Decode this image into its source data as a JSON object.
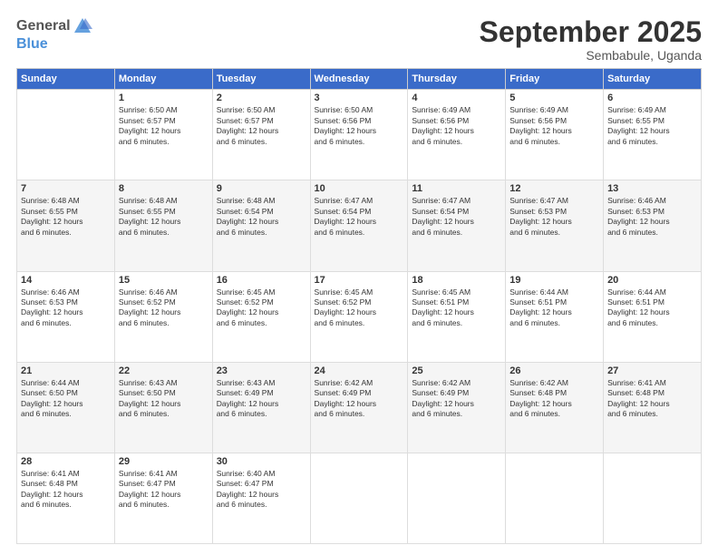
{
  "logo": {
    "general": "General",
    "blue": "Blue"
  },
  "header": {
    "month": "September 2025",
    "location": "Sembabule, Uganda"
  },
  "days": [
    "Sunday",
    "Monday",
    "Tuesday",
    "Wednesday",
    "Thursday",
    "Friday",
    "Saturday"
  ],
  "weeks": [
    [
      {
        "day": "",
        "sunrise": "",
        "sunset": "",
        "daylight": ""
      },
      {
        "day": "1",
        "sunrise": "Sunrise: 6:50 AM",
        "sunset": "Sunset: 6:57 PM",
        "daylight": "Daylight: 12 hours and 6 minutes."
      },
      {
        "day": "2",
        "sunrise": "Sunrise: 6:50 AM",
        "sunset": "Sunset: 6:57 PM",
        "daylight": "Daylight: 12 hours and 6 minutes."
      },
      {
        "day": "3",
        "sunrise": "Sunrise: 6:50 AM",
        "sunset": "Sunset: 6:56 PM",
        "daylight": "Daylight: 12 hours and 6 minutes."
      },
      {
        "day": "4",
        "sunrise": "Sunrise: 6:49 AM",
        "sunset": "Sunset: 6:56 PM",
        "daylight": "Daylight: 12 hours and 6 minutes."
      },
      {
        "day": "5",
        "sunrise": "Sunrise: 6:49 AM",
        "sunset": "Sunset: 6:56 PM",
        "daylight": "Daylight: 12 hours and 6 minutes."
      },
      {
        "day": "6",
        "sunrise": "Sunrise: 6:49 AM",
        "sunset": "Sunset: 6:55 PM",
        "daylight": "Daylight: 12 hours and 6 minutes."
      }
    ],
    [
      {
        "day": "7",
        "sunrise": "Sunrise: 6:48 AM",
        "sunset": "Sunset: 6:55 PM",
        "daylight": "Daylight: 12 hours and 6 minutes."
      },
      {
        "day": "8",
        "sunrise": "Sunrise: 6:48 AM",
        "sunset": "Sunset: 6:55 PM",
        "daylight": "Daylight: 12 hours and 6 minutes."
      },
      {
        "day": "9",
        "sunrise": "Sunrise: 6:48 AM",
        "sunset": "Sunset: 6:54 PM",
        "daylight": "Daylight: 12 hours and 6 minutes."
      },
      {
        "day": "10",
        "sunrise": "Sunrise: 6:47 AM",
        "sunset": "Sunset: 6:54 PM",
        "daylight": "Daylight: 12 hours and 6 minutes."
      },
      {
        "day": "11",
        "sunrise": "Sunrise: 6:47 AM",
        "sunset": "Sunset: 6:54 PM",
        "daylight": "Daylight: 12 hours and 6 minutes."
      },
      {
        "day": "12",
        "sunrise": "Sunrise: 6:47 AM",
        "sunset": "Sunset: 6:53 PM",
        "daylight": "Daylight: 12 hours and 6 minutes."
      },
      {
        "day": "13",
        "sunrise": "Sunrise: 6:46 AM",
        "sunset": "Sunset: 6:53 PM",
        "daylight": "Daylight: 12 hours and 6 minutes."
      }
    ],
    [
      {
        "day": "14",
        "sunrise": "Sunrise: 6:46 AM",
        "sunset": "Sunset: 6:53 PM",
        "daylight": "Daylight: 12 hours and 6 minutes."
      },
      {
        "day": "15",
        "sunrise": "Sunrise: 6:46 AM",
        "sunset": "Sunset: 6:52 PM",
        "daylight": "Daylight: 12 hours and 6 minutes."
      },
      {
        "day": "16",
        "sunrise": "Sunrise: 6:45 AM",
        "sunset": "Sunset: 6:52 PM",
        "daylight": "Daylight: 12 hours and 6 minutes."
      },
      {
        "day": "17",
        "sunrise": "Sunrise: 6:45 AM",
        "sunset": "Sunset: 6:52 PM",
        "daylight": "Daylight: 12 hours and 6 minutes."
      },
      {
        "day": "18",
        "sunrise": "Sunrise: 6:45 AM",
        "sunset": "Sunset: 6:51 PM",
        "daylight": "Daylight: 12 hours and 6 minutes."
      },
      {
        "day": "19",
        "sunrise": "Sunrise: 6:44 AM",
        "sunset": "Sunset: 6:51 PM",
        "daylight": "Daylight: 12 hours and 6 minutes."
      },
      {
        "day": "20",
        "sunrise": "Sunrise: 6:44 AM",
        "sunset": "Sunset: 6:51 PM",
        "daylight": "Daylight: 12 hours and 6 minutes."
      }
    ],
    [
      {
        "day": "21",
        "sunrise": "Sunrise: 6:44 AM",
        "sunset": "Sunset: 6:50 PM",
        "daylight": "Daylight: 12 hours and 6 minutes."
      },
      {
        "day": "22",
        "sunrise": "Sunrise: 6:43 AM",
        "sunset": "Sunset: 6:50 PM",
        "daylight": "Daylight: 12 hours and 6 minutes."
      },
      {
        "day": "23",
        "sunrise": "Sunrise: 6:43 AM",
        "sunset": "Sunset: 6:49 PM",
        "daylight": "Daylight: 12 hours and 6 minutes."
      },
      {
        "day": "24",
        "sunrise": "Sunrise: 6:42 AM",
        "sunset": "Sunset: 6:49 PM",
        "daylight": "Daylight: 12 hours and 6 minutes."
      },
      {
        "day": "25",
        "sunrise": "Sunrise: 6:42 AM",
        "sunset": "Sunset: 6:49 PM",
        "daylight": "Daylight: 12 hours and 6 minutes."
      },
      {
        "day": "26",
        "sunrise": "Sunrise: 6:42 AM",
        "sunset": "Sunset: 6:48 PM",
        "daylight": "Daylight: 12 hours and 6 minutes."
      },
      {
        "day": "27",
        "sunrise": "Sunrise: 6:41 AM",
        "sunset": "Sunset: 6:48 PM",
        "daylight": "Daylight: 12 hours and 6 minutes."
      }
    ],
    [
      {
        "day": "28",
        "sunrise": "Sunrise: 6:41 AM",
        "sunset": "Sunset: 6:48 PM",
        "daylight": "Daylight: 12 hours and 6 minutes."
      },
      {
        "day": "29",
        "sunrise": "Sunrise: 6:41 AM",
        "sunset": "Sunset: 6:47 PM",
        "daylight": "Daylight: 12 hours and 6 minutes."
      },
      {
        "day": "30",
        "sunrise": "Sunrise: 6:40 AM",
        "sunset": "Sunset: 6:47 PM",
        "daylight": "Daylight: 12 hours and 6 minutes."
      },
      {
        "day": "",
        "sunrise": "",
        "sunset": "",
        "daylight": ""
      },
      {
        "day": "",
        "sunrise": "",
        "sunset": "",
        "daylight": ""
      },
      {
        "day": "",
        "sunrise": "",
        "sunset": "",
        "daylight": ""
      },
      {
        "day": "",
        "sunrise": "",
        "sunset": "",
        "daylight": ""
      }
    ]
  ]
}
